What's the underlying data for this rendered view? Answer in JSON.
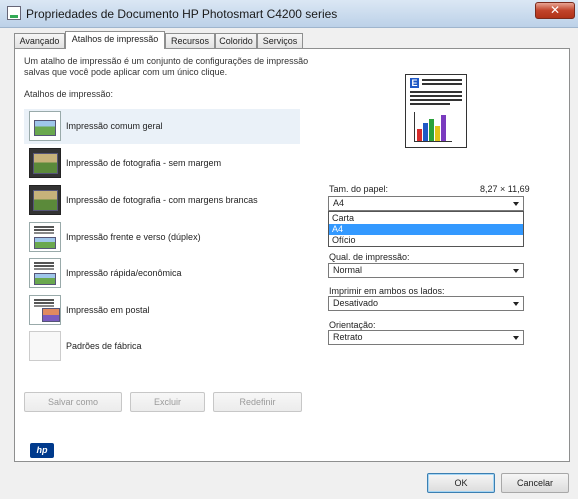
{
  "window": {
    "title": "Propriedades de Documento HP Photosmart C4200 series",
    "close_glyph": "✕"
  },
  "tabs": [
    {
      "label": "Avançado"
    },
    {
      "label": "Atalhos de impressão",
      "active": true
    },
    {
      "label": "Recursos"
    },
    {
      "label": "Colorido"
    },
    {
      "label": "Serviços"
    }
  ],
  "panel": {
    "description": "Um atalho de impressão é um conjunto de configurações de impressão salvas que você pode aplicar com um único clique.",
    "shortcuts_label": "Atalhos de impressão:"
  },
  "shortcuts": [
    {
      "label": "Impressão comum geral",
      "icon": "general-print-icon",
      "selected": true
    },
    {
      "label": "Impressão de fotografia - sem margem",
      "icon": "borderless-photo-icon"
    },
    {
      "label": "Impressão de fotografia - com margens brancas",
      "icon": "bordered-photo-icon"
    },
    {
      "label": "Impressão frente e verso (dúplex)",
      "icon": "duplex-print-icon"
    },
    {
      "label": "Impressão rápida/econômica",
      "icon": "fast-economical-icon"
    },
    {
      "label": "Impressão em postal",
      "icon": "postcard-icon"
    },
    {
      "label": "Padrões de fábrica",
      "icon": "factory-defaults-icon"
    }
  ],
  "fields": {
    "paper_size": {
      "label": "Tam. do papel:",
      "dimensions": "8,27 × 11,69",
      "value": "A4",
      "options": [
        "Carta",
        "A4",
        "Ofício"
      ],
      "selected_option": "A4"
    },
    "print_quality": {
      "label": "Qual. de impressão:",
      "value": "Normal"
    },
    "print_both_sides": {
      "label": "Imprimir em ambos os lados:",
      "value": "Desativado"
    },
    "orientation": {
      "label": "Orientação:",
      "value": "Retrato"
    }
  },
  "buttons": {
    "save_as": "Salvar como",
    "delete": "Excluir",
    "reset": "Redefinir",
    "ok": "OK",
    "cancel": "Cancelar"
  },
  "branding": {
    "logo_text": "hp"
  },
  "colors": {
    "selection": "#3399ff",
    "hp_blue": "#003a8c",
    "close_red": "#c1432a"
  }
}
